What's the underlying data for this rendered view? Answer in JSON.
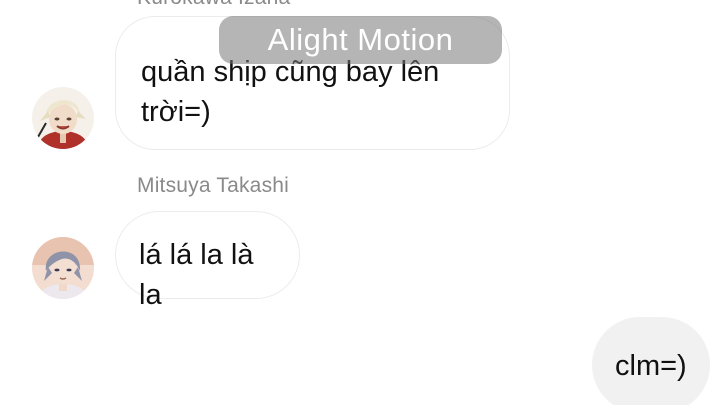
{
  "chat": {
    "messages": [
      {
        "sender": "Kurokawa Izana",
        "text": "quần shịp cũng bay lên trời=)",
        "direction": "incoming"
      },
      {
        "sender": "Mitsuya Takashi",
        "text": "lá lá la là la",
        "direction": "incoming"
      },
      {
        "sender": "",
        "text": "clm=)",
        "direction": "outgoing"
      }
    ]
  },
  "watermark": {
    "text": "Alight Motion"
  },
  "colors": {
    "background": "#ffffff",
    "incoming_bubble_border": "#ececec",
    "outgoing_bubble": "#f1f1f1",
    "sender_name": "#8a8a8a",
    "message_text": "#111111"
  }
}
